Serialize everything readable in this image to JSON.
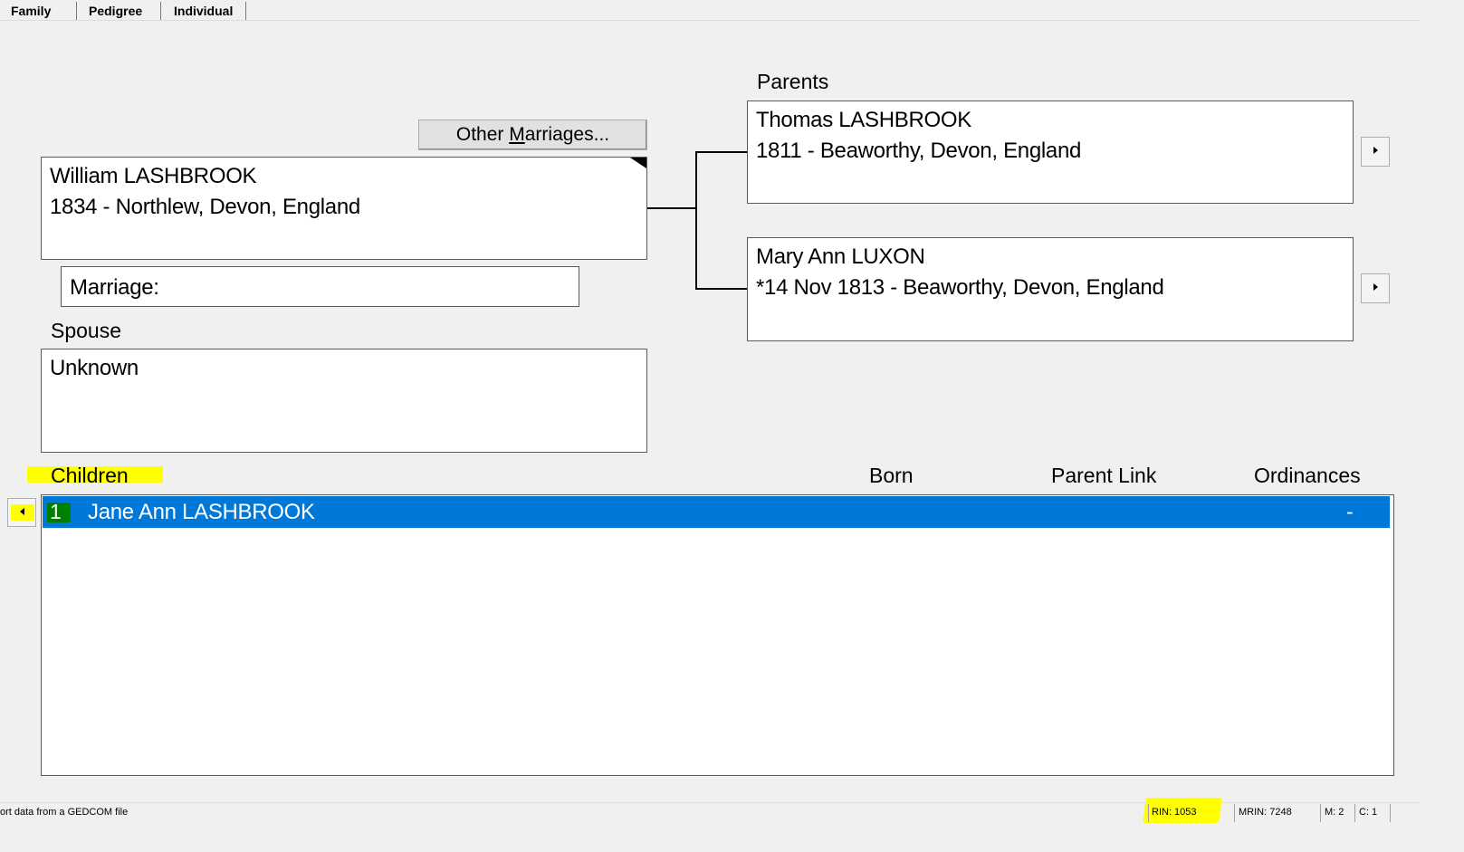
{
  "tabs": [
    {
      "label": "Family"
    },
    {
      "label": "Pedigree"
    },
    {
      "label": "Individual"
    }
  ],
  "individual": {
    "other_marriages_label": "Other Marriages...",
    "other_marriages_underline": "M",
    "name": "William LASHBROOK",
    "details": "1834 - Northlew, Devon, England",
    "marriage_label": "Marriage:"
  },
  "parents": {
    "label": "Parents",
    "father": {
      "name": "Thomas LASHBROOK",
      "details": "1811 - Beaworthy, Devon, England"
    },
    "mother": {
      "name": "Mary Ann LUXON",
      "details": "*14 Nov 1813 - Beaworthy, Devon, England"
    }
  },
  "spouse": {
    "label": "Spouse",
    "name": "Unknown"
  },
  "children": {
    "label": "Children",
    "columns": {
      "born": "Born",
      "parent_link": "Parent Link",
      "ordinances": "Ordinances"
    },
    "rows": [
      {
        "num": "1",
        "name": "Jane Ann LASHBROOK",
        "ordinances": "-"
      }
    ]
  },
  "status_bar": {
    "message": "ort data from a GEDCOM file",
    "rin": "RIN: 1053",
    "mrin": "MRIN: 7248",
    "m": "M: 2",
    "c": "C: 1"
  },
  "colors": {
    "highlight": "#ffff00",
    "selection": "#0078d7",
    "number_badge": "#008000"
  },
  "icons": {
    "father_arrow": "triangle-right",
    "mother_arrow": "triangle-right",
    "children_arrow": "triangle-left"
  }
}
